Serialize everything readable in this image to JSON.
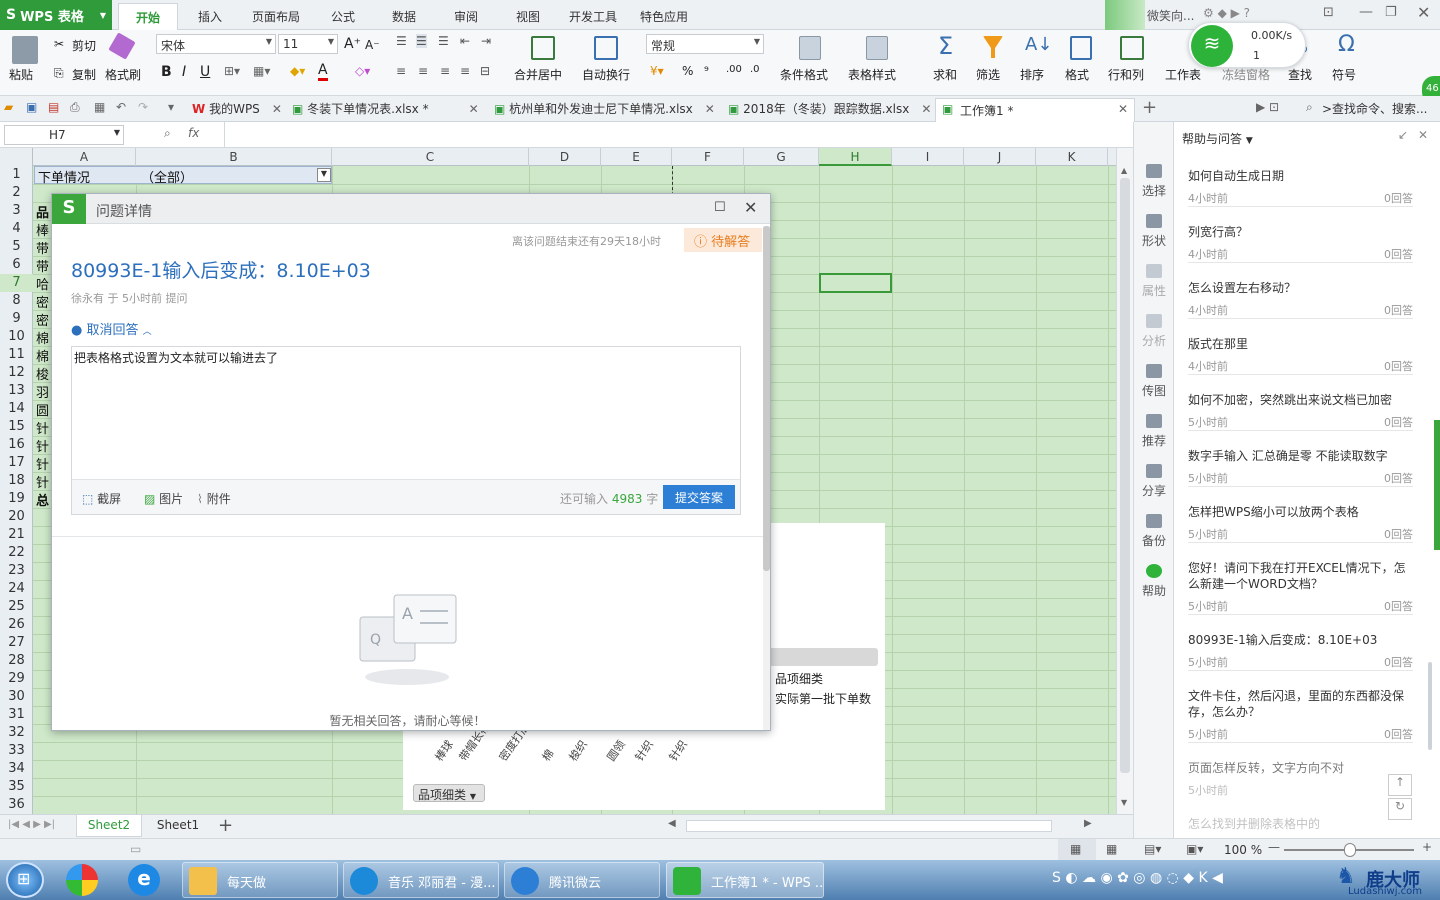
{
  "app": {
    "name": "WPS 表格"
  },
  "menu_tabs": [
    "开始",
    "插入",
    "页面布局",
    "公式",
    "数据",
    "审阅",
    "视图",
    "开发工具",
    "特色应用"
  ],
  "tray_top": {
    "user": "微笑向...",
    "net_speed": "0.00K/s",
    "net_count": "1",
    "badge": "46"
  },
  "ribbon": {
    "paste": "粘贴",
    "cut": "剪切",
    "copy": "复制",
    "format_painter": "格式刷",
    "font": "宋体",
    "font_size": "11",
    "merge_center": "合并居中",
    "wrap": "自动换行",
    "number_format": "常规",
    "cond_format": "条件格式",
    "table_style": "表格样式",
    "sum": "求和",
    "filter": "筛选",
    "sort": "排序",
    "format": "格式",
    "rows_cols": "行和列",
    "worksheet": "工作表",
    "freeze": "冻结窗格",
    "find": "查找",
    "symbol": "符号"
  },
  "doc_tabs": [
    "我的WPS",
    "冬装下单情况表.xlsx *",
    "杭州单和外发迪士尼下单情况.xlsx",
    "2018年（冬装）跟踪数据.xlsx",
    "工作簿1 *"
  ],
  "search_cmd": ">查找命令、搜索...",
  "formula_bar": {
    "cell_ref": "H7",
    "fx": "fx"
  },
  "sheet": {
    "columns": [
      "A",
      "B",
      "C",
      "D",
      "E",
      "F",
      "G",
      "H",
      "I",
      "J",
      "K"
    ],
    "rows": [
      "1",
      "2",
      "3",
      "4",
      "5",
      "6",
      "7",
      "8",
      "9",
      "10",
      "11",
      "12",
      "13",
      "14",
      "15",
      "16",
      "17",
      "18",
      "19",
      "20",
      "21",
      "22",
      "23",
      "24",
      "25",
      "26",
      "27",
      "28",
      "29",
      "30",
      "31",
      "32",
      "33",
      "34",
      "35",
      "36"
    ],
    "a1": "下单情况",
    "b1": "（全部）",
    "a_col": [
      "",
      "",
      "品",
      "棒",
      "带",
      "带",
      "哈",
      "密",
      "密",
      "棉",
      "棉",
      "梭",
      "羽",
      "圆",
      "针",
      "针",
      "针",
      "针",
      "总"
    ],
    "chart_legend_1": "品项细类",
    "chart_legend_2": "实际第一批下单数",
    "chart_filter": "品项细类",
    "chart_axis_labels": [
      "棒球",
      "带帽长袖上",
      "密度打底",
      "棉",
      "梭织",
      "圆领",
      "针织",
      "针织"
    ]
  },
  "sheet_tabs": [
    "Sheet2",
    "Sheet1"
  ],
  "status": {
    "zoom": "100 %"
  },
  "side_tools": [
    "选择",
    "形状",
    "属性",
    "分析",
    "传图",
    "推荐",
    "分享",
    "备份",
    "帮助"
  ],
  "help": {
    "title": "帮助与问答",
    "items": [
      {
        "q": "如何自动生成日期",
        "time": "4小时前",
        "answers": "0回答"
      },
      {
        "q": "列宽行高？",
        "time": "4小时前",
        "answers": "0回答"
      },
      {
        "q": "怎么设置左右移动？",
        "time": "4小时前",
        "answers": "0回答"
      },
      {
        "q": "版式在那里",
        "time": "4小时前",
        "answers": "0回答"
      },
      {
        "q": "如何不加密，突然跳出来说文档已加密",
        "time": "5小时前",
        "answers": "0回答"
      },
      {
        "q": "数字手输入 汇总确是零 不能读取数字",
        "time": "5小时前",
        "answers": "0回答"
      },
      {
        "q": "怎样把WPS缩小可以放两个表格",
        "time": "5小时前",
        "answers": "0回答"
      },
      {
        "q": "您好！请问下我在打开EXCEL情况下，怎么新建一个WORD文档？",
        "time": "5小时前",
        "answers": "0回答"
      },
      {
        "q": "80993E-1输入后变成：8.10E+03",
        "time": "5小时前",
        "answers": "0回答"
      },
      {
        "q": "文件卡住，然后闪退，里面的东西都没保存，怎么办？",
        "time": "5小时前",
        "answers": "0回答"
      },
      {
        "q": "页面怎样反转，文字方向不对",
        "time": "5小时前",
        "answers": ""
      },
      {
        "q": "怎么找到并删除表格中的",
        "time": "",
        "answers": ""
      }
    ]
  },
  "dialog": {
    "title": "问题详情",
    "countdown": "离该问题结束还有29天18小时",
    "status": "待解答",
    "question": "80993E-1输入后变成：8.10E+03",
    "asker": "徐永有 于 5小时前 提问",
    "cancel_answer": "取消回答",
    "answer_text": "把表格格式设置为文本就可以输进去了",
    "screenshot": "截屏",
    "image": "图片",
    "attach": "附件",
    "remaining_prefix": "还可输入",
    "remaining_count": "4983",
    "remaining_suffix": "字",
    "submit": "提交答案",
    "empty": "暂无相关回答，请耐心等候！"
  },
  "taskbar": {
    "items": [
      "每天做",
      "音乐 邓丽君 - 漫...",
      "腾讯微云",
      "工作簿1 * - WPS ..."
    ],
    "watermark": "鹿大师",
    "watermark_url": "Ludashiwj.com"
  }
}
